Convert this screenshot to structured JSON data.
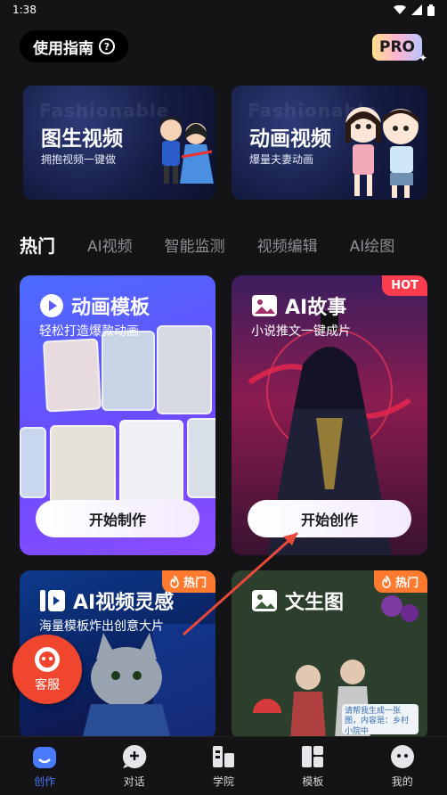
{
  "status_bar": {
    "time": "1:38"
  },
  "header": {
    "guide_label": "使用指南",
    "pro_label": "PRO"
  },
  "banners": [
    {
      "bg_text": "Fashionable",
      "title": "图生视频",
      "subtitle": "拥抱视频一键做"
    },
    {
      "bg_text": "Fashionable",
      "title": "动画视频",
      "subtitle": "爆量夫妻动画"
    }
  ],
  "tabs": [
    "热门",
    "AI视频",
    "智能监测",
    "视频编辑",
    "AI绘图"
  ],
  "cards": [
    {
      "title": "动画模板",
      "subtitle": "轻松打造爆款动画",
      "button": "开始制作"
    },
    {
      "title": "AI故事",
      "subtitle": "小说推文一键成片",
      "button": "开始创作",
      "tag": "HOT"
    },
    {
      "title": "AI视频灵感",
      "subtitle": "海量模板炸出创意大片",
      "tag": "热门"
    },
    {
      "title": "文生图",
      "tag": "热门",
      "note": "请帮我生成一张图，内容是：乡村小院中"
    }
  ],
  "service": {
    "label": "客服"
  },
  "bottom_nav": [
    {
      "label": "创作",
      "icon": "create-icon",
      "active": true
    },
    {
      "label": "对话",
      "icon": "chat-icon",
      "active": false
    },
    {
      "label": "学院",
      "icon": "academy-icon",
      "active": false
    },
    {
      "label": "模板",
      "icon": "template-icon",
      "active": false
    },
    {
      "label": "我的",
      "icon": "profile-icon",
      "active": false
    }
  ],
  "colors": {
    "background": "#141416",
    "accent": "#4a7bff",
    "hot_red": "#ff3b4e",
    "hot_orange": "#ff7a2e",
    "service_red": "#f1462e"
  }
}
